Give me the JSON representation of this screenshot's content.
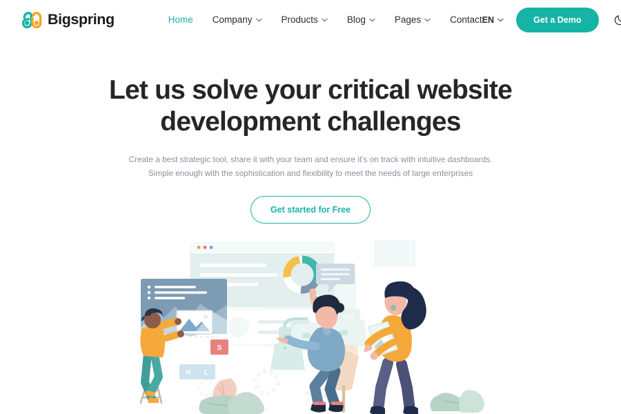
{
  "brand": {
    "name": "Bigspring",
    "logo_icon": "bigspring-droplet-logo",
    "colors": {
      "teal": "#16b4a6",
      "orange": "#f5a623"
    }
  },
  "nav": {
    "items": [
      {
        "label": "Home",
        "active": true,
        "has_dropdown": false,
        "icon": ""
      },
      {
        "label": "Company",
        "active": false,
        "has_dropdown": true,
        "icon": "chevron-down-icon"
      },
      {
        "label": "Products",
        "active": false,
        "has_dropdown": true,
        "icon": "chevron-down-icon"
      },
      {
        "label": "Blog",
        "active": false,
        "has_dropdown": true,
        "icon": "chevron-down-icon"
      },
      {
        "label": "Pages",
        "active": false,
        "has_dropdown": true,
        "icon": "chevron-down-icon"
      },
      {
        "label": "Contact",
        "active": false,
        "has_dropdown": false,
        "icon": ""
      }
    ]
  },
  "header_right": {
    "language": {
      "label": "EN",
      "icon": "chevron-down-icon"
    },
    "demo_button": {
      "label": "Get a Demo",
      "color": "#16b4a6"
    },
    "theme_toggle": {
      "icon": "moon-icon",
      "label": ""
    }
  },
  "hero": {
    "title_line_1": "Let us solve your critical website",
    "title_line_2": "development challenges",
    "subtitle_line_1": "Create a best strategic tool, share it with your team and ensure it's on track with intuitive dashboards.",
    "subtitle_line_2": "Simple enough with the sophistication and flexibility to meet the needs of large enterprises",
    "cta_label": "Get started for Free",
    "cta_color": "#1ab3a6"
  },
  "illustration": {
    "name": "team-dashboard-illustration",
    "code_tag_label": "</>",
    "tiles": [
      {
        "letter": "S",
        "color": "#e9817f"
      },
      {
        "letter": "H",
        "color": "#7fb3d0"
      },
      {
        "letter": "L",
        "color": "#7fb3d0"
      }
    ],
    "browser_dots": [
      "#f0a04b",
      "#e8776b",
      "#6fa8d6"
    ]
  }
}
